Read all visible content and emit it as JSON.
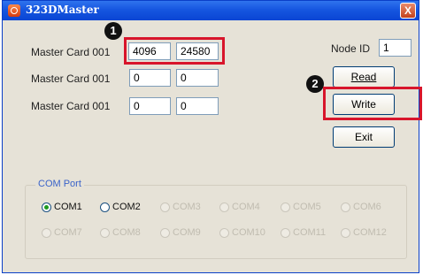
{
  "window": {
    "title": "323DMaster",
    "close_glyph": "X"
  },
  "rows": [
    {
      "label": "Master Card 001",
      "value1": "4096",
      "value2": "24580"
    },
    {
      "label": "Master Card 001",
      "value1": "0",
      "value2": "0"
    },
    {
      "label": "Master Card 001",
      "value1": "0",
      "value2": "0"
    }
  ],
  "node": {
    "label": "Node ID",
    "value": "1"
  },
  "buttons": {
    "read": "Read",
    "write": "Write",
    "exit": "Exit"
  },
  "markers": {
    "one": "1",
    "two": "2"
  },
  "com_port": {
    "title": "COM Port",
    "ports": [
      {
        "label": "COM1",
        "enabled": true,
        "selected": true
      },
      {
        "label": "COM2",
        "enabled": true,
        "selected": false
      },
      {
        "label": "COM3",
        "enabled": false,
        "selected": false
      },
      {
        "label": "COM4",
        "enabled": false,
        "selected": false
      },
      {
        "label": "COM5",
        "enabled": false,
        "selected": false
      },
      {
        "label": "COM6",
        "enabled": false,
        "selected": false
      },
      {
        "label": "COM7",
        "enabled": false,
        "selected": false
      },
      {
        "label": "COM8",
        "enabled": false,
        "selected": false
      },
      {
        "label": "COM9",
        "enabled": false,
        "selected": false
      },
      {
        "label": "COM10",
        "enabled": false,
        "selected": false
      },
      {
        "label": "COM11",
        "enabled": false,
        "selected": false
      },
      {
        "label": "COM12",
        "enabled": false,
        "selected": false
      }
    ]
  },
  "colors": {
    "highlight": "#d8152b",
    "titlebar": "#1656e0",
    "window_bg": "#e6e2d7"
  }
}
